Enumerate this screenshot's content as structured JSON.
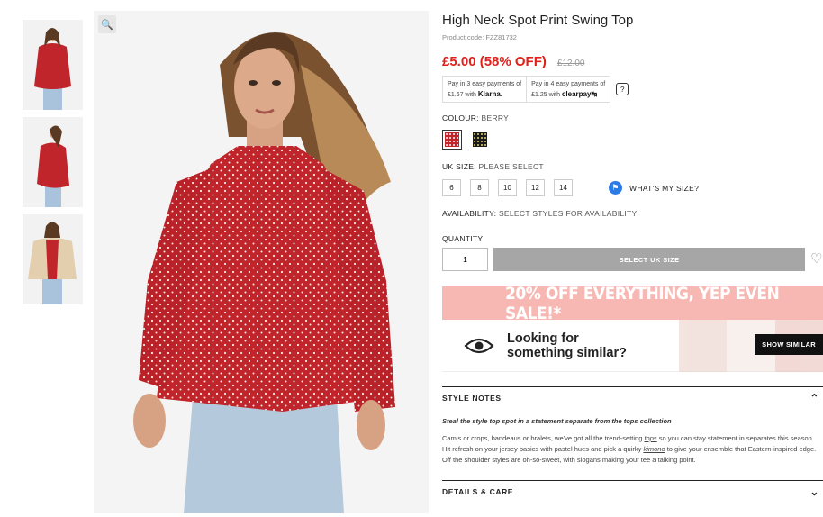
{
  "product": {
    "title": "High Neck Spot Print Swing Top",
    "code": "Product code: FZZ81732",
    "price": "£5.00 (58% OFF)",
    "was_price": "£12.00"
  },
  "payments": {
    "klarna_line1": "Pay in 3 easy payments of",
    "klarna_line2": "£1.67 with",
    "klarna_brand": "Klarna.",
    "clearpay_line1": "Pay in 4 easy payments of",
    "clearpay_line2": "£1.25 with",
    "clearpay_brand": "clearpay",
    "help": "?"
  },
  "colour": {
    "label": "COLOUR:",
    "value": "BERRY",
    "swatches": [
      "berry",
      "black"
    ]
  },
  "size": {
    "label": "UK SIZE:",
    "value": "PLEASE SELECT",
    "options": [
      "6",
      "8",
      "10",
      "12",
      "14"
    ],
    "whats_my_size": "WHAT'S MY SIZE?"
  },
  "availability": {
    "label": "AVAILABILITY:",
    "value": "SELECT STYLES FOR AVAILABILITY"
  },
  "quantity": {
    "label": "QUANTITY",
    "value": "1"
  },
  "select_button": "SELECT UK SIZE",
  "promo_banner": "20% OFF EVERYTHING, YEP EVEN SALE!*",
  "similar": {
    "line1": "Looking for",
    "line2": "something similar?",
    "button": "SHOW SIMILAR"
  },
  "style_notes": {
    "heading": "STYLE NOTES",
    "tagline": "Steal the style top spot in a statement separate from the tops collection",
    "body_1": "Camis or crops, bandeaus or bralets, we've got all the trend-setting ",
    "body_link1": "tops",
    "body_2": " so you can stay statement in separates this season. Hit refresh on your jersey basics with pastel hues and pick a quirky ",
    "body_link2": "kimono",
    "body_3": " to give your ensemble that Eastern-inspired edge. Off the shoulder styles are oh-so-sweet, with slogans making your tee a talking point."
  },
  "details": {
    "heading": "DETAILS & CARE"
  },
  "colors": {
    "price_red": "#e0201a",
    "promo_pink": "#f7b7b3",
    "button_grey": "#a6a6a6",
    "info_blue": "#2c7be5"
  },
  "icons": [
    "zoom-icon",
    "help-icon",
    "ruler-person-icon",
    "heart-icon",
    "eye-icon",
    "chevron-up-icon",
    "chevron-down-icon"
  ]
}
